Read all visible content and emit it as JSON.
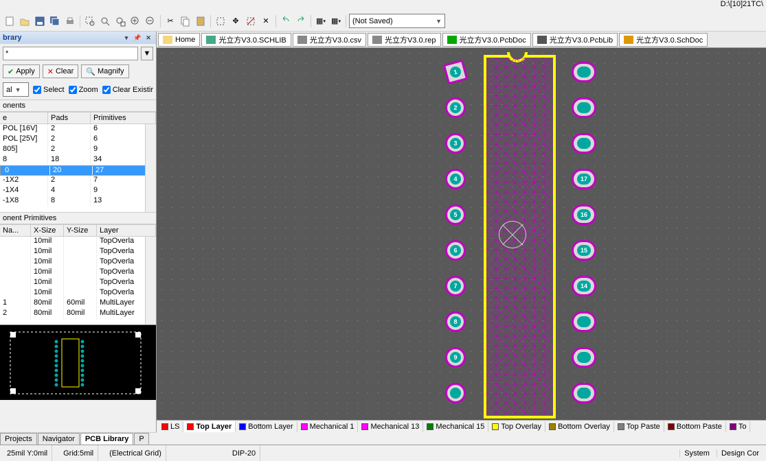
{
  "path_text": "D:\\[10]21TC\\",
  "save_combo": "(Not Saved)",
  "doc_tabs": [
    {
      "label": "Home",
      "icon": "home"
    },
    {
      "label": "光立方V3.0.SCHLIB",
      "icon": "schlib"
    },
    {
      "label": "光立方V3.0.csv",
      "icon": "csv"
    },
    {
      "label": "光立方V3.0.rep",
      "icon": "rep"
    },
    {
      "label": "光立方V3.0.PcbDoc",
      "icon": "pcbdoc",
      "active": true
    },
    {
      "label": "光立方V3.0.PcbLib",
      "icon": "pcblib"
    },
    {
      "label": "光立方V3.0.SchDoc",
      "icon": "schdoc"
    }
  ],
  "panel": {
    "title": "brary",
    "mask": "*",
    "btns": {
      "apply": "Apply",
      "clear": "Clear",
      "magnify": "Magnify"
    },
    "opts_combo_val": "al",
    "opt_select": "Select",
    "opt_zoom": "Zoom",
    "opt_clear": "Clear Existir"
  },
  "comp_section": "onents",
  "comp_cols": {
    "name": "e",
    "pads": "Pads",
    "prims": "Primitives"
  },
  "comp_rows": [
    {
      "n": "POL [16V]",
      "p": "2",
      "r": "6"
    },
    {
      "n": "POL [25V]",
      "p": "2",
      "r": "6"
    },
    {
      "n": "805]",
      "p": "2",
      "r": "9"
    },
    {
      "n": "8",
      "p": "18",
      "r": "34"
    },
    {
      "n": "0",
      "p": "20",
      "r": "27",
      "sel": true
    },
    {
      "n": "-1X2",
      "p": "2",
      "r": "7"
    },
    {
      "n": "-1X4",
      "p": "4",
      "r": "9"
    },
    {
      "n": "-1X8",
      "p": "8",
      "r": "13"
    }
  ],
  "prim_section": "onent Primitives",
  "prim_cols": {
    "name": "Na...",
    "xs": "X-Size",
    "ys": "Y-Size",
    "layer": "Layer"
  },
  "prim_rows": [
    {
      "n": "",
      "xs": "10mil",
      "ys": "",
      "l": "TopOverla"
    },
    {
      "n": "",
      "xs": "10mil",
      "ys": "",
      "l": "TopOverla"
    },
    {
      "n": "",
      "xs": "10mil",
      "ys": "",
      "l": "TopOverla"
    },
    {
      "n": "",
      "xs": "10mil",
      "ys": "",
      "l": "TopOverla"
    },
    {
      "n": "",
      "xs": "10mil",
      "ys": "",
      "l": "TopOverla"
    },
    {
      "n": "",
      "xs": "10mil",
      "ys": "",
      "l": "TopOverla"
    },
    {
      "n": "1",
      "xs": "80mil",
      "ys": "60mil",
      "l": "MultiLayer"
    },
    {
      "n": "2",
      "xs": "80mil",
      "ys": "80mil",
      "l": "MultiLayer"
    }
  ],
  "layer_tabs": [
    {
      "label": "LS",
      "color": "#ff0000",
      "pre": true
    },
    {
      "label": "Top Layer",
      "color": "#ff0000",
      "active": true
    },
    {
      "label": "Bottom Layer",
      "color": "#0000ff"
    },
    {
      "label": "Mechanical 1",
      "color": "#ff00ff"
    },
    {
      "label": "Mechanical 13",
      "color": "#ff00ff"
    },
    {
      "label": "Mechanical 15",
      "color": "#008000"
    },
    {
      "label": "Top Overlay",
      "color": "#ffff00"
    },
    {
      "label": "Bottom Overlay",
      "color": "#a08000"
    },
    {
      "label": "Top Paste",
      "color": "#808080"
    },
    {
      "label": "Bottom Paste",
      "color": "#800000"
    },
    {
      "label": "To",
      "color": "#800080"
    }
  ],
  "bottom_tabs": [
    "Projects",
    "Navigator",
    "PCB Library",
    "P"
  ],
  "bottom_active": 2,
  "status": {
    "coords": "25mil Y:0mil",
    "grid": "Grid:5mil",
    "mode": "(Electrical Grid)",
    "comp": "DIP-20",
    "system": "System",
    "design": "Design Cor"
  },
  "pads_left": [
    "1",
    "2",
    "3",
    "4",
    "5",
    "6",
    "7",
    "8",
    "9",
    ""
  ],
  "pads_right": [
    "",
    "",
    "",
    "17",
    "16",
    "15",
    "14",
    "",
    "",
    ""
  ]
}
